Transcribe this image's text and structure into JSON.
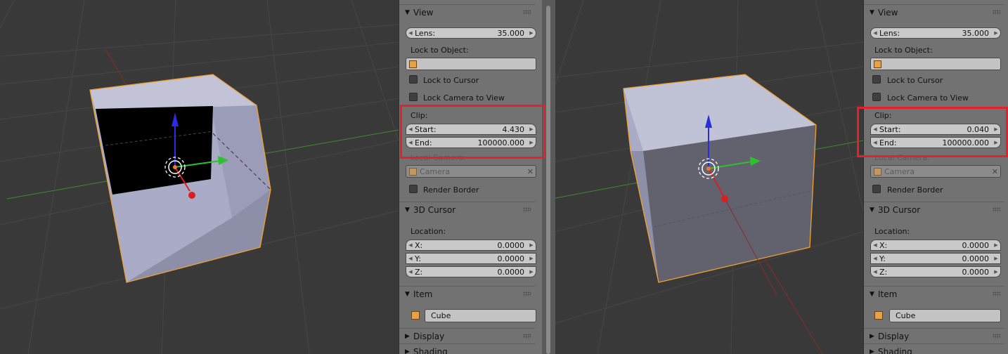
{
  "left": {
    "view": {
      "header": "View",
      "lens_label": "Lens:",
      "lens_value": "35.000",
      "lock_to_object_label": "Lock to Object:",
      "lock_to_cursor": "Lock to Cursor",
      "lock_camera_to_view": "Lock Camera to View",
      "clip_label": "Clip:",
      "clip_start_label": "Start:",
      "clip_start_value": "4.430",
      "clip_end_label": "End:",
      "clip_end_value": "100000.000",
      "local_camera_label": "Local Camera:",
      "local_camera_value": "Camera",
      "render_border": "Render Border"
    },
    "cursor": {
      "header": "3D Cursor",
      "location_label": "Location:",
      "x_label": "X:",
      "x_value": "0.0000",
      "y_label": "Y:",
      "y_value": "0.0000",
      "z_label": "Z:",
      "z_value": "0.0000"
    },
    "item": {
      "header": "Item",
      "name": "Cube"
    },
    "display": {
      "header": "Display"
    },
    "shading": {
      "header": "Shading"
    }
  },
  "right": {
    "view": {
      "header": "View",
      "lens_label": "Lens:",
      "lens_value": "35.000",
      "lock_to_object_label": "Lock to Object:",
      "lock_to_cursor": "Lock to Cursor",
      "lock_camera_to_view": "Lock Camera to View",
      "clip_label": "Clip:",
      "clip_start_label": "Start:",
      "clip_start_value": "0.040",
      "clip_end_label": "End:",
      "clip_end_value": "100000.000",
      "local_camera_label": "Local Camera:",
      "local_camera_value": "Camera",
      "render_border": "Render Border"
    },
    "cursor": {
      "header": "3D Cursor",
      "location_label": "Location:",
      "x_label": "X:",
      "x_value": "0.0000",
      "y_label": "Y:",
      "y_value": "0.0000",
      "z_label": "Z:",
      "z_value": "0.0000"
    },
    "item": {
      "header": "Item",
      "name": "Cube"
    },
    "display": {
      "header": "Display"
    },
    "shading": {
      "header": "Shading"
    }
  },
  "colors": {
    "viewport_bg": "#393939",
    "panel_bg": "#727272",
    "highlight": "#e5202b",
    "selection_outline": "#f0a030"
  }
}
